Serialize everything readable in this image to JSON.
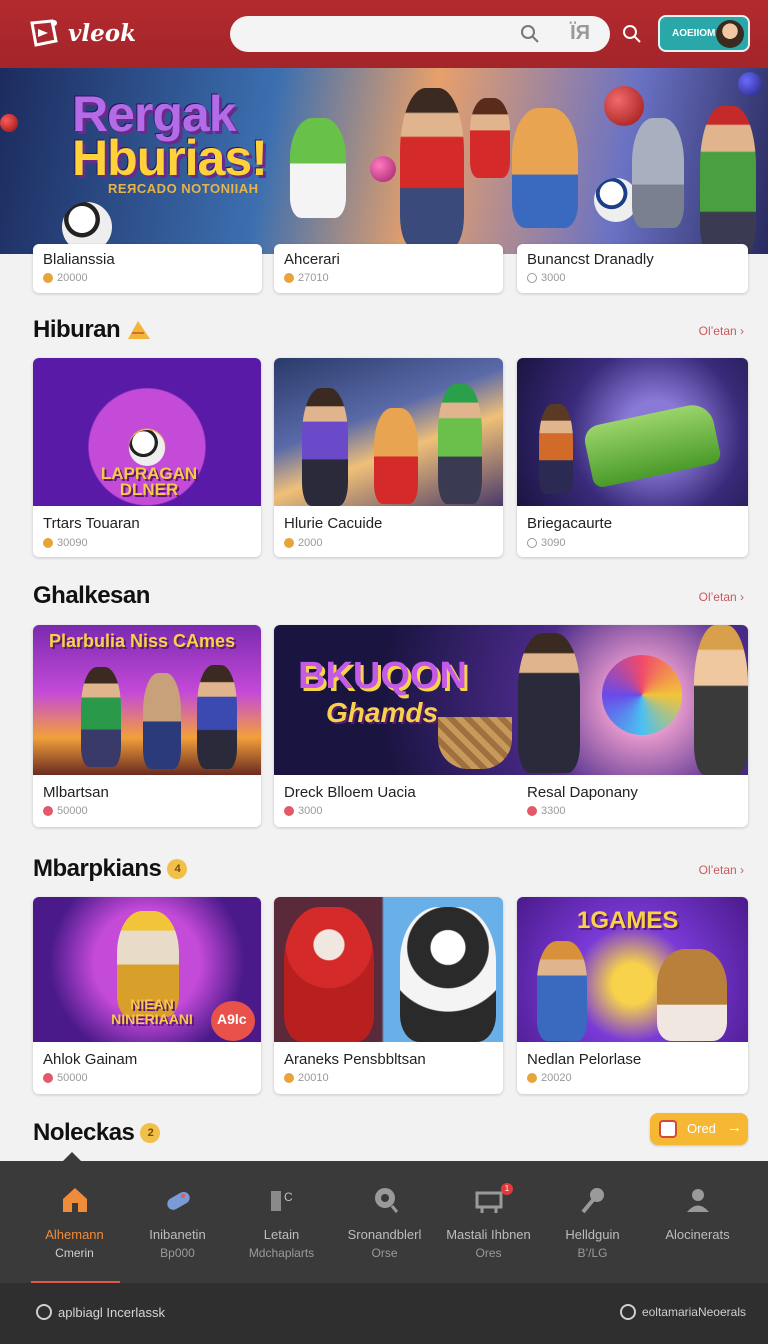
{
  "header": {
    "logo_text": "vleok",
    "search_glyph": "ЇЯ",
    "account_label": "AOEIIOM",
    "brand_color": "#b32a2e"
  },
  "hero": {
    "title_line1": "Rergak",
    "title_line2": "Hburias!",
    "subtitle": "REЯCADO NOTONIIAH"
  },
  "strip": [
    {
      "title": "Blalianssia",
      "meta": "20000"
    },
    {
      "title": "Ahcerari",
      "meta": "27010"
    },
    {
      "title": "Bunancst Dranadly",
      "meta": "3000"
    }
  ],
  "sections": [
    {
      "title": "Hiburan",
      "more": "Ol’etan ›",
      "cards": [
        {
          "title": "Trtars Touaran",
          "meta": "30090",
          "image_text": "LAPRAGAN DLNER"
        },
        {
          "title": "Hlurie Cacuide",
          "meta": "2000"
        },
        {
          "title": "Briegacaurte",
          "meta": "3090"
        }
      ]
    },
    {
      "title": "Ghalkesan",
      "more": "Ol’etan ›",
      "cards": [
        {
          "title": "Mlbartsan",
          "meta": "50000",
          "image_text": "Plarbulia Niss CAmes"
        },
        {
          "title": "Dreck Blloem Uacia",
          "meta": "3000",
          "image_text_1": "BKUQON",
          "image_text_2": "Ghamds"
        },
        {
          "title": "Resal Daponany",
          "meta": "3300"
        }
      ]
    },
    {
      "title": "Mbarpkians",
      "more": "Ol’etan ›",
      "badge": "4",
      "cards": [
        {
          "title": "Ahlok Gainam",
          "meta": "50000",
          "image_text": "NIEAN NINERIAANI",
          "image_tag": "A9lc"
        },
        {
          "title": "Araneks Pensbbltsan",
          "meta": "20010"
        },
        {
          "title": "Nedlan Pelorlase",
          "meta": "20020",
          "image_text": "1GAMES"
        }
      ]
    },
    {
      "title": "Noleckas",
      "badge": "2"
    }
  ],
  "order_button": {
    "label": "Ored"
  },
  "bottom_nav": [
    {
      "label1": "Alhemann",
      "label2": "Cmerin",
      "icon": "home-icon",
      "active": true
    },
    {
      "label1": "Inibanetin",
      "label2": "Bp000",
      "icon": "controller-icon"
    },
    {
      "label1": "Letain",
      "label2": "Mdchaplarts",
      "icon": "chart-icon"
    },
    {
      "label1": "Sronandblerl",
      "label2": "Orse",
      "icon": "globe-icon"
    },
    {
      "label1": "Mastali Ihbnen",
      "label2": "Ores",
      "icon": "cart-icon",
      "badge": "1"
    },
    {
      "label1": "Helldguin",
      "label2": "B’/LG",
      "icon": "wrench-icon"
    },
    {
      "label1": "Alocinerats",
      "label2": "",
      "icon": "user-icon"
    }
  ],
  "footer": {
    "left": "aplbiagl Incerlassk",
    "right": "eoltamariaNeoerals"
  }
}
